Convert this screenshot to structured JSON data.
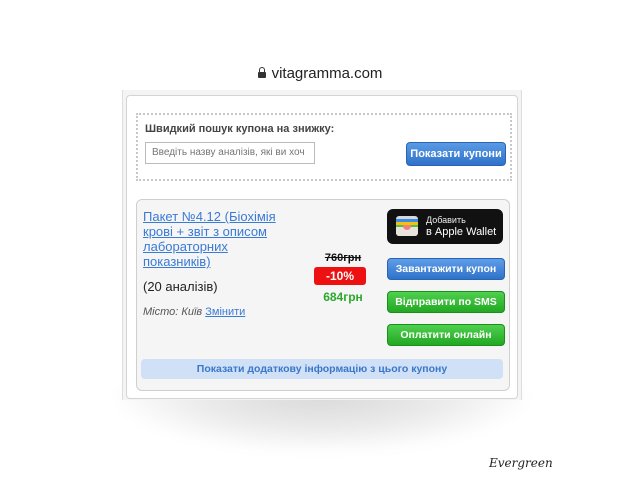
{
  "browser": {
    "url": "vitagramma.com",
    "lock_icon": "lock-icon"
  },
  "search": {
    "label": "Швидкий пошук купона на знижку:",
    "placeholder": "Введіть назву аналізів, які ви хоч",
    "button": "Показати купони"
  },
  "coupon": {
    "title": "Пакет №4.12 (Біохімія крові + звіт з описом лабораторних показників)",
    "count": "(20 аналізів)",
    "city_label": "Місто: Київ",
    "change_link": "Змінити",
    "price_old": "760грн",
    "discount": "-10%",
    "price_new": "684грн",
    "wallet": {
      "line1": "Добавить",
      "line2": "в Apple Wallet",
      "icon": "wallet-icon"
    },
    "buttons": {
      "download": "Завантажити купон",
      "sms": "Відправити по SMS",
      "pay": "Оплатити онлайн"
    },
    "more_info": "Показати додаткову інформацію з цього купону"
  },
  "watermark": "Evergreen",
  "colors": {
    "link": "#3a7bd5",
    "discount": "#ee1111",
    "price_new": "#2ba82b",
    "button_blue": "#2f72c9",
    "button_green": "#22a822"
  }
}
